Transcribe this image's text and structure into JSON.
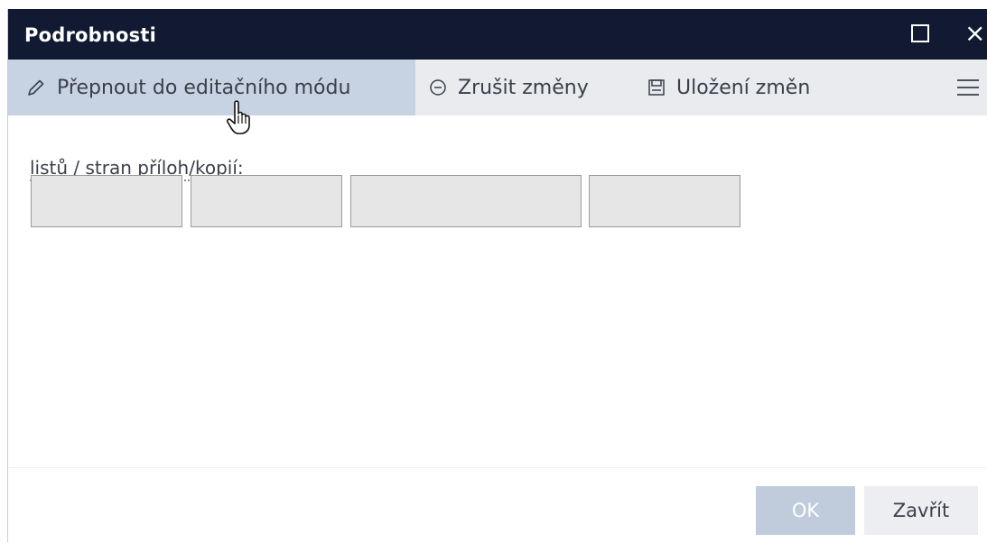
{
  "dialog": {
    "title": "Podrobnosti"
  },
  "toolbar": {
    "edit_mode_label": "Přepnout do editačního módu",
    "cancel_label": "Zrušit změny",
    "save_label": "Uložení změn",
    "icons": {
      "edit": "pencil-icon",
      "cancel": "minus-circle-icon",
      "save": "floppy-disk-icon",
      "menu": "hamburger-menu-icon"
    }
  },
  "form": {
    "field_label": "listů / stran příloh/kopií:",
    "inputs": [
      "",
      "",
      "",
      ""
    ]
  },
  "footer": {
    "ok_label": "OK",
    "close_label": "Zavřít"
  },
  "colors": {
    "titlebar": "#121a33",
    "toolbar": "#e9ebee",
    "active_tool": "#c7d3e3",
    "ok_disabled": "#c0ccdb"
  }
}
